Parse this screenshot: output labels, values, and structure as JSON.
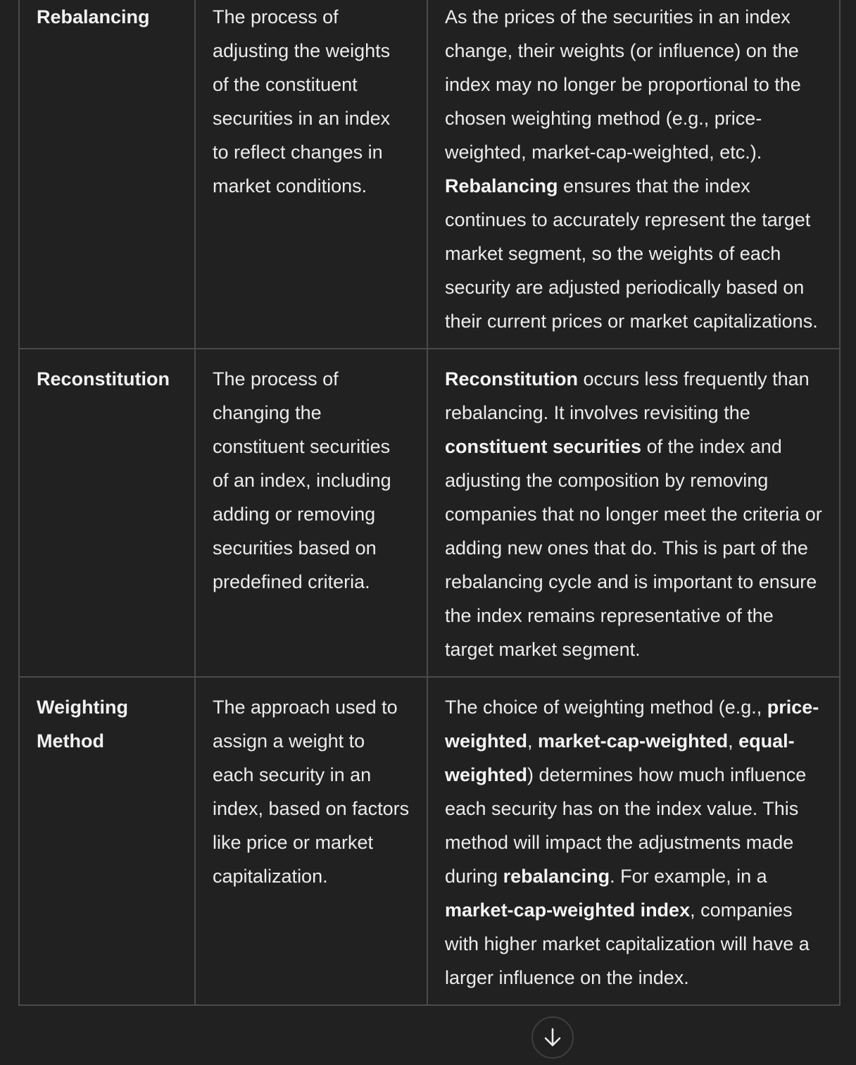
{
  "rows": [
    {
      "term": "Rebalancing",
      "definition": "The process of adjusting the weights of the constituent securities in an index to reflect changes in market conditions.",
      "detail": [
        {
          "t": "As the prices of the securities in an index change, their weights (or influence) on the index may no longer be proportional to the chosen weighting method (e.g., price-weighted, market-cap-weighted, etc.). ",
          "b": false
        },
        {
          "t": "Rebalancing",
          "b": true
        },
        {
          "t": " ensures that the index continues to accurately represent the target market segment, so the weights of each security are adjusted periodically based on their current prices or market capitalizations.",
          "b": false
        }
      ]
    },
    {
      "term": "Reconstitution",
      "definition": "The process of changing the constituent securities of an index, including adding or removing securities based on predefined criteria.",
      "detail": [
        {
          "t": "Reconstitution",
          "b": true
        },
        {
          "t": " occurs less frequently than rebalancing. It involves revisiting the ",
          "b": false
        },
        {
          "t": "constituent securities",
          "b": true
        },
        {
          "t": " of the index and adjusting the composition by removing companies that no longer meet the criteria or adding new ones that do. This is part of the rebalancing cycle and is important to ensure the index remains representative of the target market segment.",
          "b": false
        }
      ]
    },
    {
      "term": "Weighting Method",
      "definition": "The approach used to assign a weight to each security in an index, based on factors like price or market capitalization.",
      "detail": [
        {
          "t": "The choice of weighting method (e.g., ",
          "b": false
        },
        {
          "t": "price-weighted",
          "b": true
        },
        {
          "t": ", ",
          "b": false
        },
        {
          "t": "market-cap-weighted",
          "b": true
        },
        {
          "t": ", ",
          "b": false
        },
        {
          "t": "equal-weighted",
          "b": true
        },
        {
          "t": ") determines how much influence each security has on the index value. This method will impact the adjustments made during ",
          "b": false
        },
        {
          "t": "rebalancing",
          "b": true
        },
        {
          "t": ". For example, in a ",
          "b": false
        },
        {
          "t": "market-cap-weighted index",
          "b": true
        },
        {
          "t": ", companies with higher market capitalization will have a larger influence on the index.",
          "b": false
        }
      ]
    }
  ],
  "scroll_button": {
    "icon": "arrow-down-icon"
  }
}
